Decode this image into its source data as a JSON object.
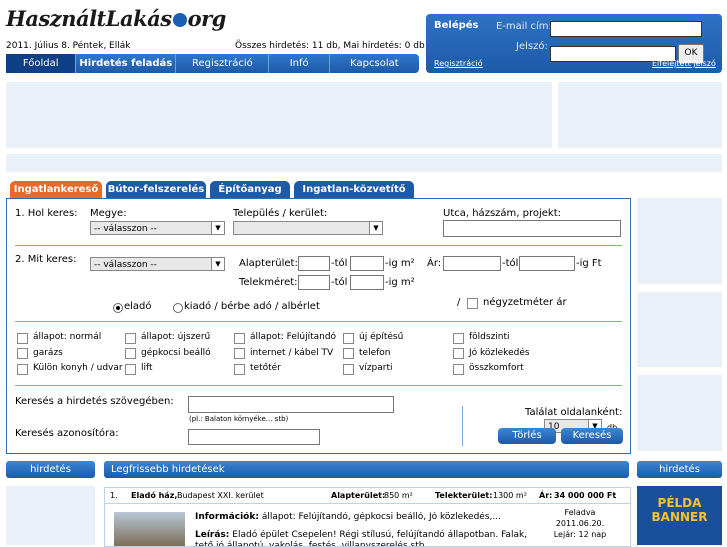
{
  "header": {
    "logo_left": "HasználtLakás",
    "logo_right": "org",
    "date": "2011. Július 8. Péntek, Ellák",
    "stats": "Összes hirdetés: 11 db, Mai hirdetés: 0 db"
  },
  "nav": [
    "Főoldal",
    "Hirdetés feladás",
    "Regisztráció",
    "Infó",
    "Kapcsolat"
  ],
  "login": {
    "title": "Belépés",
    "email_label": "E-mail cím:",
    "password_label": "Jelszó:",
    "ok": "OK",
    "register": "Regisztráció",
    "forgot": "Elfelejtett jelszó"
  },
  "tabs": [
    "Ingatlankereső",
    "Bútor-felszerelés",
    "Építőanyag",
    "Ingatlan-közvetítő"
  ],
  "search": {
    "q1": "1. Hol keres:",
    "county_label": "Megye:",
    "county_value": "-- válasszon --",
    "city_label": "Település / kerület:",
    "street_label": "Utca, házszám, projekt:",
    "q2": "2. Mit keres:",
    "type_value": "-- válasszon --",
    "area_label": "Alapterület:",
    "tol": "-tól",
    "ig_m2": "-ig m²",
    "price_label": "Ár:",
    "ig_ft": "-ig Ft",
    "plot_label": "Telekméret:",
    "sale": "eladó",
    "rent": "kiadó / bérbe adó / albérlet",
    "slash": "/",
    "sqm_price": "négyzetméter ár",
    "text_search_label": "Keresés a hirdetés szövegében:",
    "text_hint": "(pl.: Balaton környéke... stb)",
    "id_label": "Keresés azonosítóra:",
    "per_page_label": "Találat oldalanként:",
    "per_page_value": "10",
    "per_page_unit": "db",
    "clear": "Törlés",
    "submit": "Keresés"
  },
  "features": [
    [
      "állapot: normál",
      "állapot: újszerű",
      "állapot: Felújítandó",
      "új építésű",
      "földszinti"
    ],
    [
      "garázs",
      "gépkocsi beálló",
      "internet / kábel TV",
      "telefon",
      "Jó közlekedés"
    ],
    [
      "Külön konyh / udvar",
      "lift",
      "tetőtér",
      "vízparti",
      "összkomfort"
    ]
  ],
  "side": {
    "left_bar": "hirdetés",
    "right_bar": "hirdetés",
    "latest": "Legfrissebb hirdetések",
    "banner_line1": "PÉLDA",
    "banner_line2": "BANNER"
  },
  "listing": {
    "num": "1.",
    "title": "Eladó ház,",
    "location": "Budapest XXI. kerület",
    "area_label": "Alapterület:",
    "area_value": "850 m²",
    "plot_label": "Telekterület:",
    "plot_value": "1300 m²",
    "price_label": "Ár:",
    "price_value": "34 000 000 Ft",
    "info_label": "Információk:",
    "info_value": "állapot: Felújítandó, gépkocsi beálló, Jó közlekedés,...",
    "desc_label": "Leírás:",
    "desc_value": "Eladó épület Csepelen! Régi stílusú, felújítandó állapotban. Falak, tető jó állapotú, vakolás, festés, villanyszerelés stb.",
    "posted_label": "Feladva",
    "posted_date": "2011.06.20.",
    "expires": "Lejár: 12 nap"
  },
  "colors": {
    "nav_blue": "#1d5aa8",
    "active_tab": "#e8692a",
    "ad_bg": "#eaf0f8"
  }
}
